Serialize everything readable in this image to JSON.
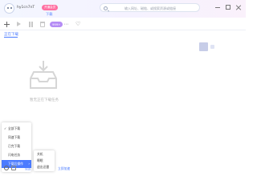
{
  "header": {
    "username": "hy1cn7nT",
    "vip_badge": "开通会员",
    "tab_label": "下载",
    "search_placeholder": "输入网址、磁链、或搜索资源或链接"
  },
  "toolbar": {
    "badge_label": "999+"
  },
  "section": {
    "title": "正在下载"
  },
  "empty": {
    "text": "暂无正在下载任务"
  },
  "left_menu": {
    "items": [
      {
        "label": "全部下载",
        "checked": true,
        "active": false
      },
      {
        "label": "同速下载",
        "checked": false,
        "active": false
      },
      {
        "label": "已完下载",
        "checked": false,
        "active": false
      },
      {
        "label": "闪电任务",
        "checked": false,
        "active": false
      },
      {
        "label": "下载后操作",
        "checked": false,
        "active": true
      }
    ],
    "check_glyph": "✓",
    "arrow_glyph": "›"
  },
  "sub_menu": {
    "items": [
      {
        "label": "关机"
      },
      {
        "label": "睡眠"
      },
      {
        "label": "退出迅雷"
      }
    ]
  },
  "bottom_bar": {
    "text": "设置",
    "link": "立即加速"
  },
  "colors": {
    "accent": "#4b7bff",
    "vip": "#ff6fa1",
    "badge": "#b58cf5"
  },
  "icons": [
    "avatar-icon",
    "search-icon",
    "minimize-icon",
    "maximize-icon",
    "close-icon",
    "add-icon",
    "start-icon",
    "pause-icon",
    "delete-icon",
    "more-icon",
    "heart-icon",
    "empty-box-icon",
    "gear-icon"
  ]
}
